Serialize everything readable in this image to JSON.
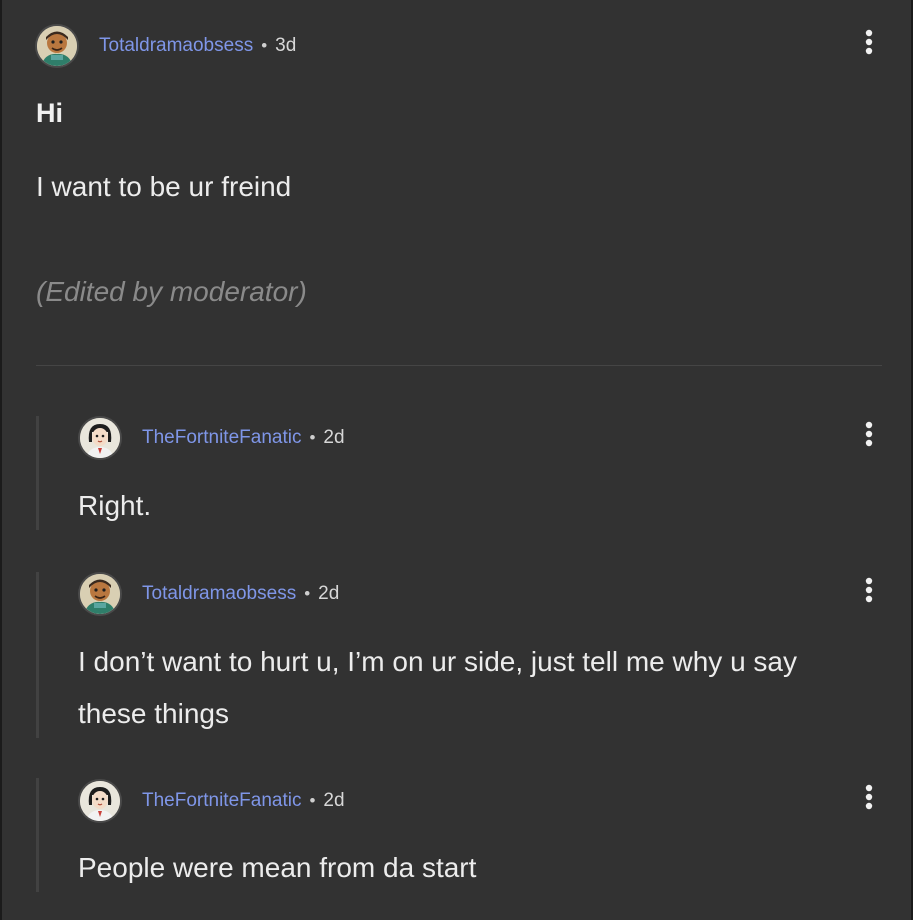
{
  "post": {
    "author": "Totaldramaobsess",
    "age": "3d",
    "title": "Hi",
    "body": "I want to be ur freind",
    "edited_note": "(Edited by moderator)"
  },
  "separator": "•",
  "replies": [
    {
      "author": "TheFortniteFanatic",
      "age": "2d",
      "text": "Right."
    },
    {
      "author": "Totaldramaobsess",
      "age": "2d",
      "text": "I don’t want to hurt u, I’m on ur side, just tell me why u say these things"
    },
    {
      "author": "TheFortniteFanatic",
      "age": "2d",
      "text": "People were mean from da start"
    }
  ],
  "icons": {
    "options": "vertical-dots-icon",
    "avatar_totaldrama": "cartoon-avatar-icon",
    "avatar_fortnite": "cartoon-girl-avatar-icon"
  },
  "colors": {
    "background": "#323232",
    "username": "#7f96e8",
    "text": "#ececec",
    "muted": "#8a8a8a"
  }
}
